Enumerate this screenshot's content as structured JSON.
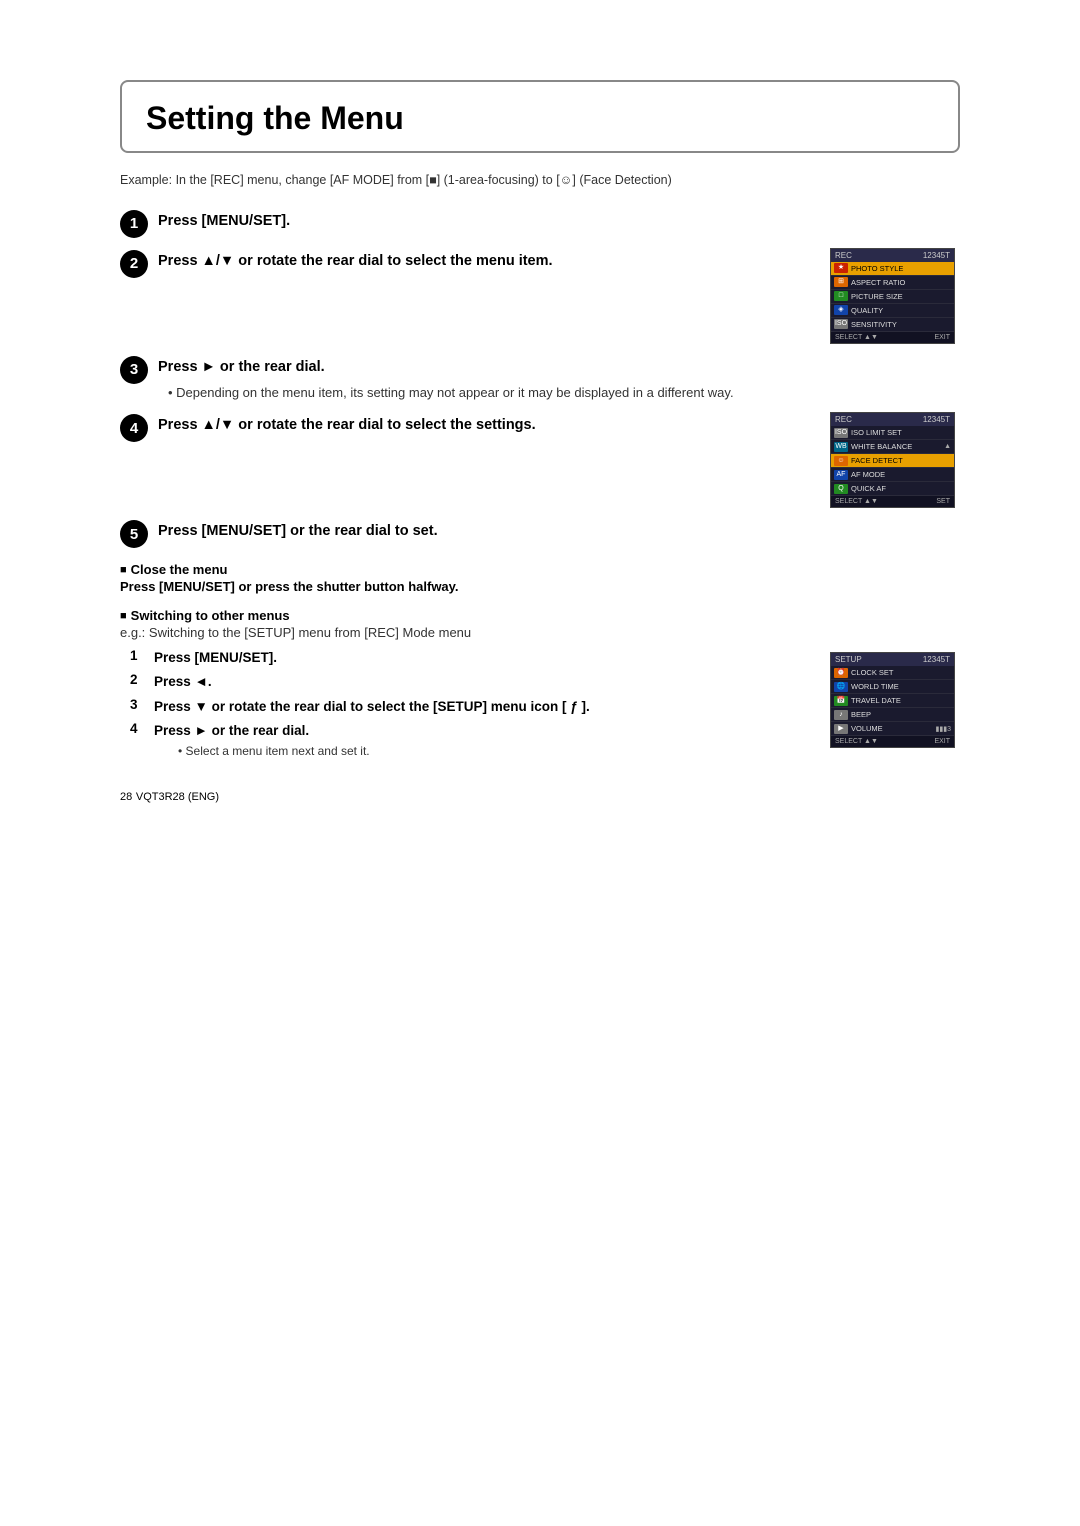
{
  "page": {
    "title": "Setting the Menu",
    "example_text": "Example: In the [REC] menu, change [AF MODE] from [■] (1-area-focusing) to [☺] (Face Detection)",
    "steps": [
      {
        "number": "1",
        "text": "Press [MENU/SET].",
        "has_image": false
      },
      {
        "number": "2",
        "text": "Press ▲/▼ or rotate the rear dial to select the menu item.",
        "has_image": true,
        "image_id": "rec-menu-screen"
      },
      {
        "number": "3",
        "text": "Press ► or the rear dial.",
        "has_image": false,
        "sub_bullet": "Depending on the menu item, its setting may not appear or it may be displayed in a different way."
      },
      {
        "number": "4",
        "text": "Press ▲/▼ or rotate the rear dial to select the settings.",
        "has_image": true,
        "image_id": "rec-settings-screen"
      },
      {
        "number": "5",
        "text": "Press [MENU/SET] or the rear dial to set.",
        "has_image": false
      }
    ],
    "close_menu": {
      "label": "Close the menu",
      "action": "Press [MENU/SET] or press the shutter button halfway."
    },
    "switching_menus": {
      "label": "Switching to other menus",
      "example": "e.g.: Switching to the [SETUP] menu from [REC] Mode menu",
      "sub_steps": [
        {
          "num": "1",
          "text": "Press [MENU/SET]."
        },
        {
          "num": "2",
          "text": "Press ◄."
        },
        {
          "num": "3",
          "text": "Press ▼ or rotate the rear dial to select the [SETUP] menu icon [ ƒ ].",
          "has_image": true,
          "image_id": "setup-screen"
        },
        {
          "num": "4",
          "text": "Press ► or the rear dial.",
          "note": "Select a menu item next and set it."
        }
      ]
    },
    "footer": {
      "page_number": "28",
      "doc_number": "VQT3R28 (ENG)"
    },
    "screens": {
      "rec_menu": {
        "title": "REC",
        "tabs": "12345T",
        "rows": [
          {
            "label": "PHOTO STYLE",
            "icon_color": "red",
            "icon_text": "★",
            "highlighted": true
          },
          {
            "label": "ASPECT RATIO",
            "icon_color": "orange",
            "icon_text": "⊞",
            "highlighted": false
          },
          {
            "label": "PICTURE SIZE",
            "icon_color": "green",
            "icon_text": "□",
            "highlighted": false
          },
          {
            "label": "QUALITY",
            "icon_color": "blue",
            "icon_text": "◈",
            "highlighted": false
          },
          {
            "label": "SENSITIVITY",
            "icon_color": "gray",
            "icon_text": "ISO",
            "highlighted": false
          }
        ],
        "footer_left": "SELECT",
        "footer_right": "EXIT"
      },
      "rec_settings": {
        "title": "REC",
        "tabs": "12345T",
        "rows": [
          {
            "label": "ISO LIMIT SET",
            "icon_color": "gray",
            "icon_text": "ISO",
            "highlighted": false
          },
          {
            "label": "WHITE BALANCE",
            "icon_color": "cyan",
            "icon_text": "WB",
            "highlighted": false,
            "value": "▲"
          },
          {
            "label": "FACE DETECT",
            "icon_color": "orange",
            "icon_text": "☺",
            "highlighted": true,
            "value": ""
          },
          {
            "label": "AF MODE",
            "icon_color": "blue",
            "icon_text": "AF",
            "highlighted": false
          },
          {
            "label": "QUICK AF",
            "icon_color": "green",
            "icon_text": "Q",
            "highlighted": false
          }
        ],
        "footer_left": "SELECT",
        "footer_right": "SET"
      },
      "setup_screen": {
        "title": "SETUP",
        "tabs": "12345T",
        "rows": [
          {
            "label": "CLOCK SET",
            "icon_color": "orange",
            "icon_text": "⏰",
            "highlighted": false
          },
          {
            "label": "WORLD TIME",
            "icon_color": "blue",
            "icon_text": "🌐",
            "highlighted": false
          },
          {
            "label": "TRAVEL DATE",
            "icon_color": "green",
            "icon_text": "📅",
            "highlighted": false
          },
          {
            "label": "BEEP",
            "icon_color": "gray",
            "icon_text": "♪",
            "highlighted": false
          },
          {
            "label": "VOLUME",
            "icon_color": "gray",
            "icon_text": "▶",
            "highlighted": false,
            "value": "▮▮▮3"
          }
        ],
        "footer_left": "SELECT",
        "footer_right": "EXIT"
      }
    }
  }
}
